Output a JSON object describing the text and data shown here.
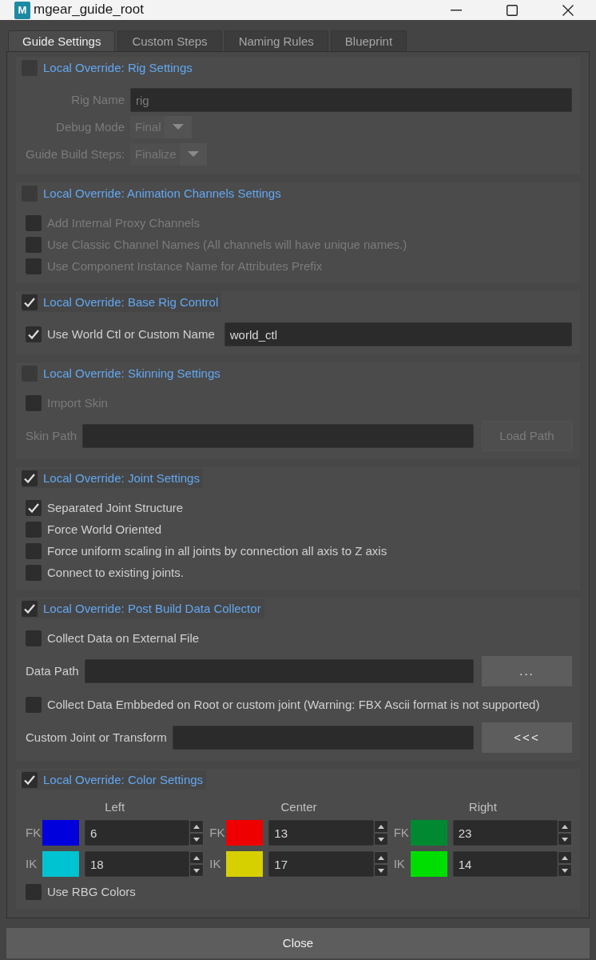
{
  "window": {
    "app_logo": "M",
    "title": "mgear_guide_root"
  },
  "tabs": [
    {
      "label": "Guide Settings",
      "selected": true
    },
    {
      "label": "Custom Steps",
      "selected": false
    },
    {
      "label": "Naming Rules",
      "selected": false
    },
    {
      "label": "Blueprint",
      "selected": false
    }
  ],
  "sections": [
    {
      "title": "Local Override: Rig Settings",
      "checked": false,
      "items": [
        {
          "kind": "text-field",
          "label": "Rig Name",
          "value": "rig"
        },
        {
          "kind": "dropdown",
          "label": "Debug Mode",
          "value": "Final"
        },
        {
          "kind": "dropdown",
          "label": "Guide Build Steps:",
          "value": "Finalize"
        }
      ]
    },
    {
      "title": "Local Override: Animation Channels Settings",
      "checked": false,
      "items": [
        {
          "kind": "checkbox",
          "label": "Add Internal Proxy Channels",
          "checked": false
        },
        {
          "kind": "checkbox",
          "label": "Use Classic Channel Names (All channels will have unique names.)",
          "checked": false
        },
        {
          "kind": "checkbox",
          "label": "Use Component Instance Name for Attributes Prefix",
          "checked": false
        }
      ]
    },
    {
      "title": "Local Override: Base Rig Control",
      "checked": true,
      "items": [
        {
          "kind": "check-field",
          "label": "Use World Ctl or Custom Name",
          "checked": true,
          "value": "world_ctl"
        }
      ]
    },
    {
      "title": "Local Override: Skinning Settings",
      "checked": false,
      "items": [
        {
          "kind": "checkbox",
          "label": "Import Skin",
          "checked": false
        },
        {
          "kind": "path-row",
          "label": "Skin Path",
          "button": "Load Path"
        }
      ]
    },
    {
      "title": "Local Override: Joint Settings",
      "checked": true,
      "items": [
        {
          "kind": "checkbox",
          "label": "Separated Joint Structure",
          "checked": true
        },
        {
          "kind": "checkbox",
          "label": "Force World Oriented",
          "checked": false
        },
        {
          "kind": "checkbox",
          "label": "Force uniform scaling in all joints by connection all axis to Z axis",
          "checked": false
        },
        {
          "kind": "checkbox",
          "label": "Connect to existing joints.",
          "checked": false
        }
      ]
    },
    {
      "title": "Local Override: Post Build Data Collector",
      "checked": true,
      "items": [
        {
          "kind": "checkbox",
          "label": "Collect Data on External File",
          "checked": false
        },
        {
          "kind": "path-row",
          "label": "Data Path",
          "button": "..."
        },
        {
          "kind": "checkbox",
          "label": "Collect Data Embbeded on Root or custom joint (Warning: FBX Ascii format is not supported)",
          "checked": false
        },
        {
          "kind": "path-row",
          "label": "Custom Joint or Transform",
          "button": "<<<"
        }
      ]
    },
    {
      "title": "Local Override: Color Settings",
      "checked": true,
      "items": [
        {
          "kind": "color-grid",
          "columns": [
            {
              "heading": "Left",
              "rows": [
                {
                  "label": "FK",
                  "color": "#0000dc",
                  "value": "6"
                },
                {
                  "label": "IK",
                  "color": "#00c3d1",
                  "value": "18"
                }
              ]
            },
            {
              "heading": "Center",
              "rows": [
                {
                  "label": "FK",
                  "color": "#ef0000",
                  "value": "13"
                },
                {
                  "label": "IK",
                  "color": "#d6d000",
                  "value": "17"
                }
              ]
            },
            {
              "heading": "Right",
              "rows": [
                {
                  "label": "FK",
                  "color": "#008931",
                  "value": "23"
                },
                {
                  "label": "IK",
                  "color": "#00dd00",
                  "value": "14"
                }
              ]
            }
          ]
        },
        {
          "kind": "checkbox",
          "label": "Use RBG Colors",
          "checked": false
        }
      ]
    }
  ],
  "close_button": "Close"
}
